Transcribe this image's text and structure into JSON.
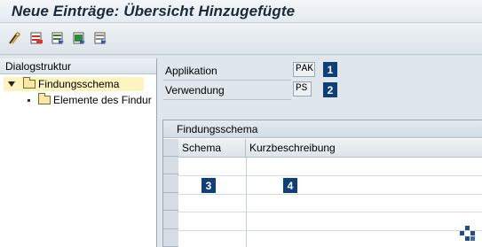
{
  "window": {
    "title": "Neue Einträge: Übersicht Hinzugefügte"
  },
  "toolbar": {
    "buttons": [
      {
        "icon": "glasses-icon"
      },
      {
        "icon": "delete-entries-icon"
      },
      {
        "icon": "select-block-icon"
      },
      {
        "icon": "select-all-icon"
      },
      {
        "icon": "deselect-all-icon"
      }
    ]
  },
  "dialog_structure": {
    "header": "Dialogstruktur",
    "items": [
      {
        "label": "Findungsschema",
        "selected": true
      },
      {
        "label": "Elemente des Findur"
      }
    ]
  },
  "fields": {
    "application": {
      "label": "Applikation",
      "value": "PAK",
      "marker": "1"
    },
    "usage": {
      "label": "Verwendung",
      "value": "PS",
      "marker": "2"
    }
  },
  "table": {
    "title": "Findungsschema",
    "columns": [
      "Schema",
      "Kurzbeschreibung"
    ],
    "markers": [
      "3",
      "4"
    ]
  },
  "colors": {
    "marker_bg": "#0f3f78",
    "selected_row": "#fdf4bf"
  }
}
